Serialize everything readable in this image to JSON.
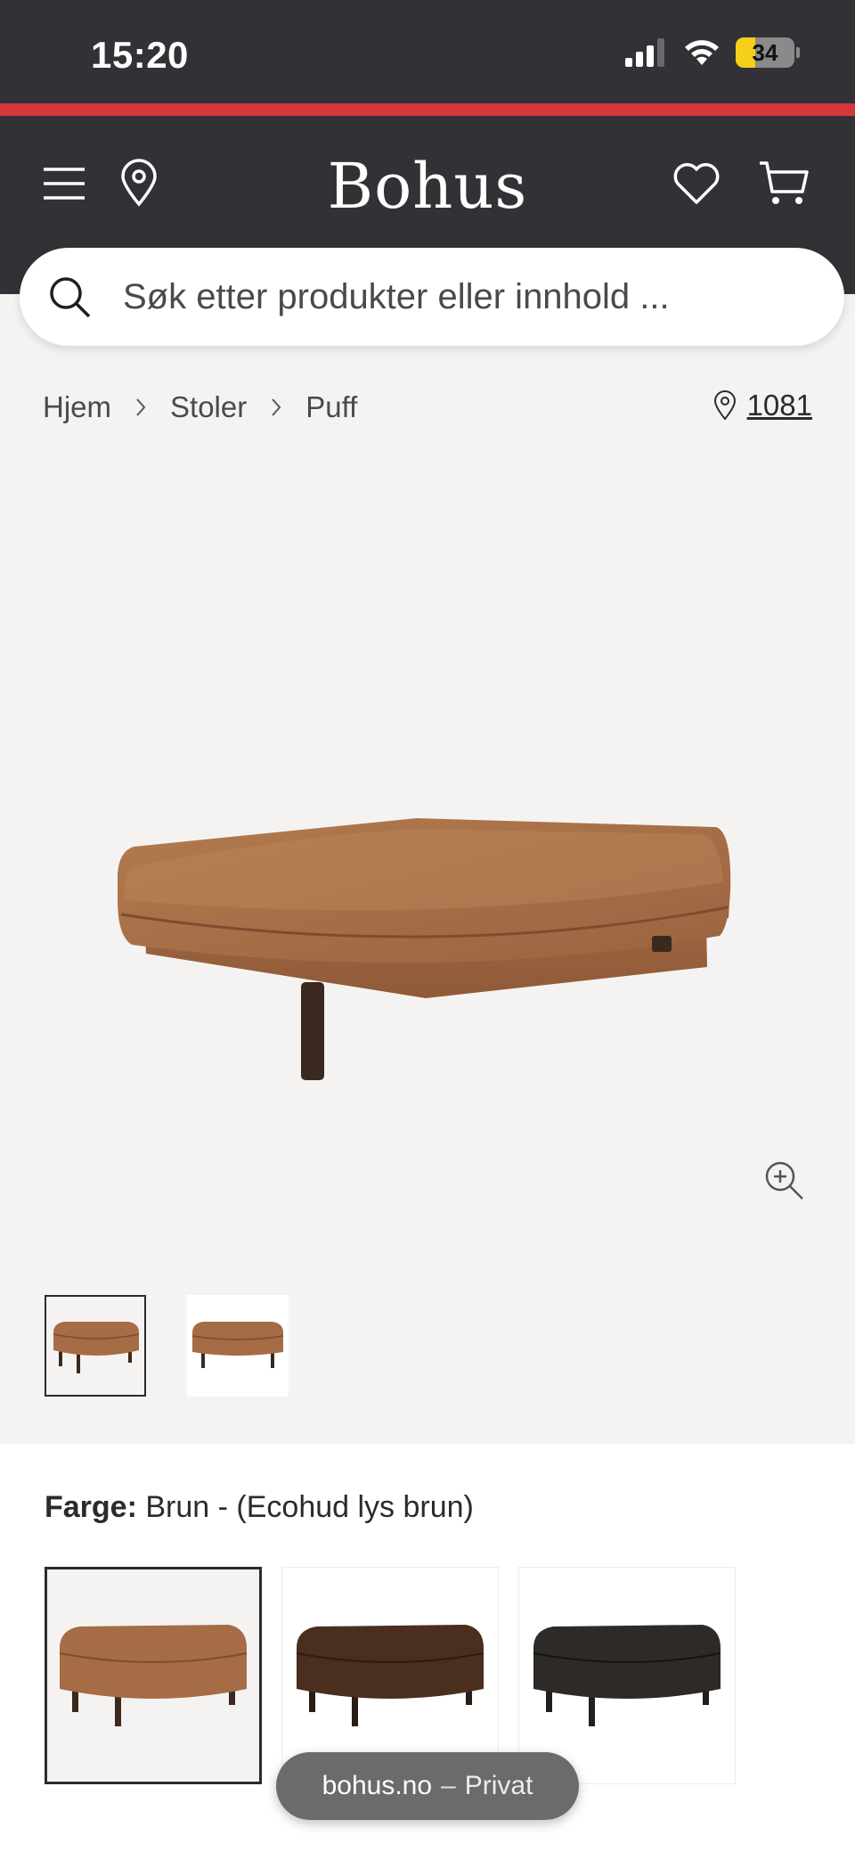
{
  "status_bar": {
    "time": "15:20",
    "battery": "34",
    "icons": [
      "signal-icon",
      "wifi-icon",
      "battery-icon"
    ]
  },
  "header": {
    "logo": "Bohus",
    "icons": [
      "menu-icon",
      "location-pin-icon",
      "heart-icon",
      "cart-icon"
    ],
    "accent_color": "#d6383a",
    "background_color": "#323236"
  },
  "search": {
    "placeholder": "Søk etter produkter eller innhold ..."
  },
  "breadcrumb": {
    "items": [
      "Hjem",
      "Stoler",
      "Puff"
    ]
  },
  "store": {
    "code": "1081"
  },
  "product": {
    "main_image": "brown-leather-ottoman",
    "thumbnails": [
      "ottoman-front-view",
      "ottoman-side-view"
    ],
    "selected_thumbnail": 0
  },
  "color": {
    "label": "Farge:",
    "value": "Brun - (Ecohud lys brun)",
    "options": [
      "light-brown",
      "dark-brown",
      "black"
    ],
    "selected": 0,
    "swatch_colors": [
      "#a26a42",
      "#4a2e1e",
      "#2d2a28"
    ]
  },
  "browser": {
    "domain": "bohus.no",
    "separator": "–",
    "mode": "Privat"
  }
}
